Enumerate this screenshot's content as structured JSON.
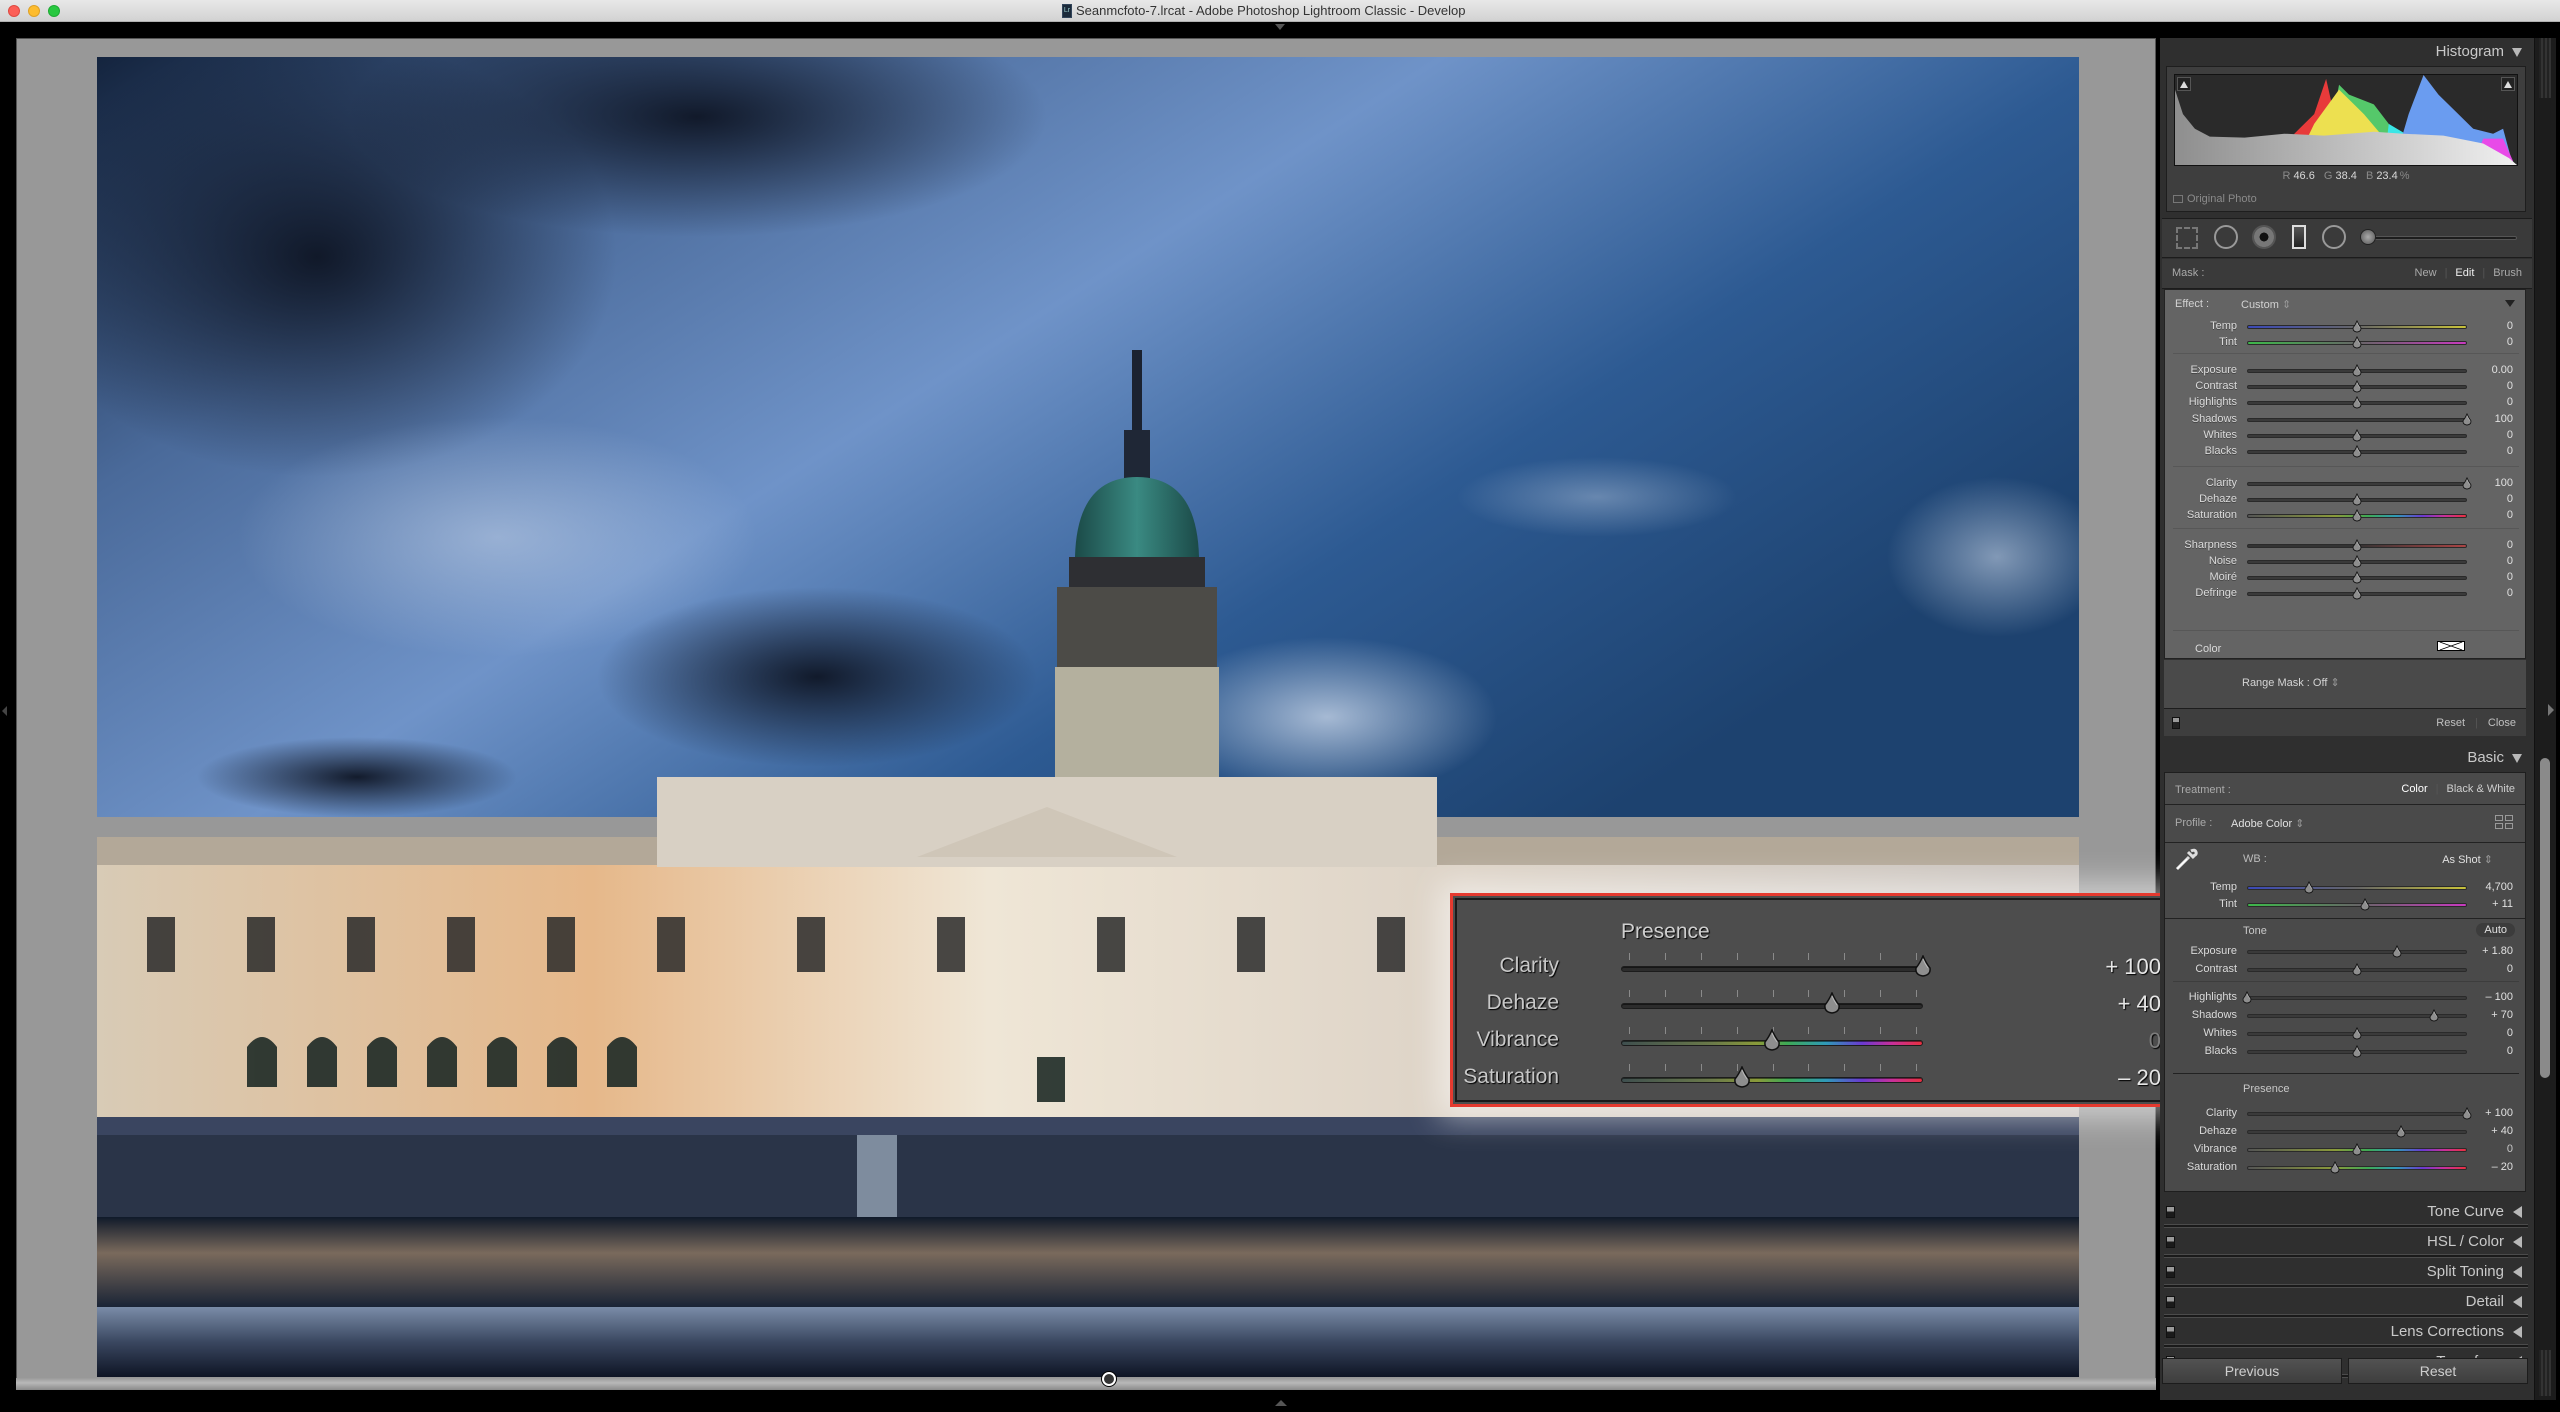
{
  "window": {
    "title": "Seanmcfoto-7.lrcat - Adobe Photoshop Lightroom Classic - Develop",
    "app_icon": "lightroom-icon",
    "app_badge": "Lr"
  },
  "photo": {
    "subject": "Custom House, Dublin at dusk with dramatic blue sky and river Liffey reflections"
  },
  "callout": {
    "title": "Presence",
    "sliders": [
      {
        "label": "Clarity",
        "value_text": "+ 100",
        "value": 100,
        "min": -100,
        "max": 100,
        "track": "neutral"
      },
      {
        "label": "Dehaze",
        "value_text": "+ 40",
        "value": 40,
        "min": -100,
        "max": 100,
        "track": "neutral"
      },
      {
        "label": "Vibrance",
        "value_text": "0",
        "value": 0,
        "min": -100,
        "max": 100,
        "track": "rainbow"
      },
      {
        "label": "Saturation",
        "value_text": "– 20",
        "value": -20,
        "min": -100,
        "max": 100,
        "track": "rainbow"
      }
    ],
    "highlight_color": "#e53a2f"
  },
  "right_panel": {
    "histogram": {
      "title": "Histogram",
      "readout": {
        "r_label": "R",
        "r": "46.6",
        "g_label": "G",
        "g": "38.4",
        "b_label": "B",
        "b": "23.4",
        "unit": "%"
      },
      "original_photo_label": "Original Photo"
    },
    "tools": [
      "crop-overlay-icon",
      "spot-removal-icon",
      "red-eye-icon",
      "graduated-filter-icon",
      "radial-filter-icon",
      "adjustment-brush-icon"
    ],
    "mask": {
      "label": "Mask :",
      "options": [
        "New",
        "Edit",
        "Brush"
      ],
      "selected": "Edit"
    },
    "effect": {
      "label": "Effect :",
      "preset": "Custom",
      "groups": [
        [
          {
            "label": "Temp",
            "value_text": "0",
            "value": 0,
            "min": -100,
            "max": 100,
            "track": "temp"
          },
          {
            "label": "Tint",
            "value_text": "0",
            "value": 0,
            "min": -100,
            "max": 100,
            "track": "tint"
          }
        ],
        [
          {
            "label": "Exposure",
            "value_text": "0.00",
            "value": 0,
            "min": -4,
            "max": 4,
            "track": "neutral"
          },
          {
            "label": "Contrast",
            "value_text": "0",
            "value": 0,
            "min": -100,
            "max": 100,
            "track": "neutral"
          },
          {
            "label": "Highlights",
            "value_text": "0",
            "value": 0,
            "min": -100,
            "max": 100,
            "track": "neutral"
          },
          {
            "label": "Shadows",
            "value_text": "100",
            "value": 100,
            "min": -100,
            "max": 100,
            "track": "neutral"
          },
          {
            "label": "Whites",
            "value_text": "0",
            "value": 0,
            "min": -100,
            "max": 100,
            "track": "neutral"
          },
          {
            "label": "Blacks",
            "value_text": "0",
            "value": 0,
            "min": -100,
            "max": 100,
            "track": "neutral"
          }
        ],
        [
          {
            "label": "Clarity",
            "value_text": "100",
            "value": 100,
            "min": -100,
            "max": 100,
            "track": "neutral"
          },
          {
            "label": "Dehaze",
            "value_text": "0",
            "value": 0,
            "min": -100,
            "max": 100,
            "track": "neutral"
          },
          {
            "label": "Saturation",
            "value_text": "0",
            "value": 0,
            "min": -100,
            "max": 100,
            "track": "rainbow"
          }
        ],
        [
          {
            "label": "Sharpness",
            "value_text": "0",
            "value": 0,
            "min": -100,
            "max": 100,
            "track": "sharp"
          },
          {
            "label": "Noise",
            "value_text": "0",
            "value": 0,
            "min": -100,
            "max": 100,
            "track": "neutral"
          },
          {
            "label": "Moiré",
            "value_text": "0",
            "value": 0,
            "min": -100,
            "max": 100,
            "track": "neutral"
          },
          {
            "label": "Defringe",
            "value_text": "0",
            "value": 0,
            "min": -100,
            "max": 100,
            "track": "neutral"
          }
        ]
      ],
      "color_label": "Color",
      "range_mask": "Range Mask : Off",
      "reset_label": "Reset",
      "close_label": "Close"
    },
    "basic": {
      "title": "Basic",
      "treatment_label": "Treatment :",
      "treatment_options": [
        "Color",
        "Black & White"
      ],
      "treatment_selected": "Color",
      "profile_label": "Profile :",
      "profile_value": "Adobe Color",
      "wb_label": "WB :",
      "wb_value": "As Shot",
      "wb_sliders": [
        {
          "label": "Temp",
          "value_text": "4,700",
          "value": 4700,
          "min": 2000,
          "max": 50000,
          "pos": 0.28,
          "track": "temp"
        },
        {
          "label": "Tint",
          "value_text": "+ 11",
          "value": 11,
          "min": -150,
          "max": 150,
          "track": "tint"
        }
      ],
      "tone_label": "Tone",
      "auto_label": "Auto",
      "tone_sliders_a": [
        {
          "label": "Exposure",
          "value_text": "+ 1.80",
          "value": 1.8,
          "min": -5,
          "max": 5,
          "track": "neutral"
        },
        {
          "label": "Contrast",
          "value_text": "0",
          "value": 0,
          "min": -100,
          "max": 100,
          "track": "neutral"
        }
      ],
      "tone_sliders_b": [
        {
          "label": "Highlights",
          "value_text": "– 100",
          "value": -100,
          "min": -100,
          "max": 100,
          "track": "neutral"
        },
        {
          "label": "Shadows",
          "value_text": "+ 70",
          "value": 70,
          "min": -100,
          "max": 100,
          "track": "neutral"
        },
        {
          "label": "Whites",
          "value_text": "0",
          "value": 0,
          "min": -100,
          "max": 100,
          "track": "neutral"
        },
        {
          "label": "Blacks",
          "value_text": "0",
          "value": 0,
          "min": -100,
          "max": 100,
          "track": "neutral"
        }
      ],
      "presence_label": "Presence",
      "presence_sliders": [
        {
          "label": "Clarity",
          "value_text": "+ 100",
          "value": 100,
          "min": -100,
          "max": 100,
          "track": "neutral"
        },
        {
          "label": "Dehaze",
          "value_text": "+ 40",
          "value": 40,
          "min": -100,
          "max": 100,
          "track": "neutral"
        },
        {
          "label": "Vibrance",
          "value_text": "0",
          "value": 0,
          "min": -100,
          "max": 100,
          "track": "rainbow"
        },
        {
          "label": "Saturation",
          "value_text": "– 20",
          "value": -20,
          "min": -100,
          "max": 100,
          "track": "rainbow"
        }
      ]
    },
    "collapsed_sections": [
      {
        "name": "Tone Curve"
      },
      {
        "name": "HSL / Color"
      },
      {
        "name": "Split Toning"
      },
      {
        "name": "Detail"
      },
      {
        "name": "Lens Corrections"
      },
      {
        "name": "Transform"
      }
    ],
    "footer": {
      "previous_label": "Previous",
      "reset_label": "Reset"
    }
  }
}
